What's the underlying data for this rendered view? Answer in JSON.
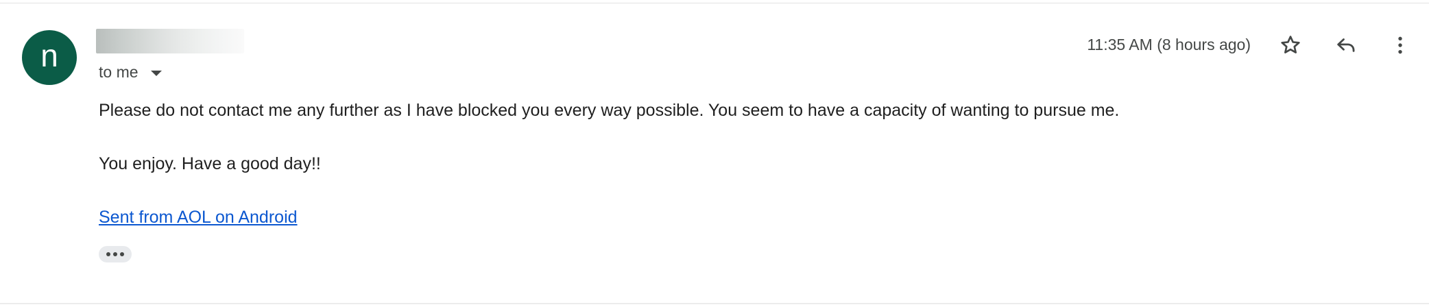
{
  "message": {
    "avatar_letter": "n",
    "avatar_color": "#0b5c47",
    "sender_name": "",
    "recipient_label": "to me",
    "timestamp": "11:35 AM (8 hours ago)",
    "body": {
      "line1": "Please do not contact me any further as I have blocked you every way possible. You seem to have a capacity of wanting to pursue me.",
      "line2": "You enjoy. Have a good day!!"
    },
    "signature_link": "Sent from AOL on Android",
    "link_color": "#0b57d0"
  },
  "icons": {
    "star": "star-icon",
    "reply": "reply-icon",
    "more": "more-vert-icon",
    "expand": "chevron-down-icon",
    "trimmed": "more-horiz-icon"
  }
}
